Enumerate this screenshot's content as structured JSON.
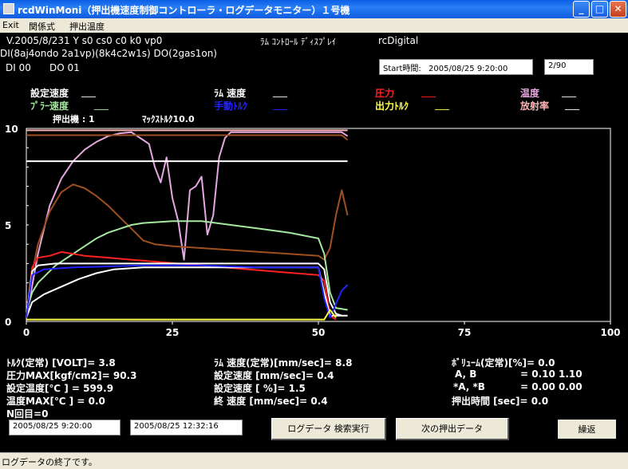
{
  "window": {
    "title": "rcdWinMoni（押出機速度制御コントローラ・ログデータモニター）１号機",
    "minimize": "_",
    "maximize": "□",
    "close": "✕"
  },
  "menu": [
    "Exit",
    "関係式",
    "押出温度"
  ],
  "header": {
    "line1": "V.2005/8/231 Y s0 cs0 c0 k0 vp0",
    "display_title": "ﾗﾑ ｺﾝﾄﾛｰﾙ ﾃﾞｨｽﾌﾟﾚｲ",
    "brand": "rcDigital",
    "line2": "DI(8aj4ondo 2a1vp)(8k4c2w1s)  DO(2gas1on)",
    "di": "DI 00",
    "do": "DO 01",
    "start_label": "Start時間:",
    "start_value": "2005/08/25 9:20:00",
    "counter": "2/90"
  },
  "legend": {
    "row1": [
      {
        "label": "設定速度",
        "value": "___",
        "color": "#ffffff"
      },
      {
        "label": "ﾗﾑ 速度",
        "value": "___",
        "color": "#ffffff"
      },
      {
        "label": "圧力",
        "value": "___",
        "color": "#ff2020"
      },
      {
        "label": "温度",
        "value": "___",
        "color": "#e6a8e0"
      }
    ],
    "row2": [
      {
        "label": "ﾌﾟﾗｰ速度",
        "value": "___",
        "color": "#a6e8a0"
      },
      {
        "label": "手動ﾄﾙｸ",
        "value": "___",
        "color": "#2222ff"
      },
      {
        "label": "出力ﾄﾙｸ",
        "value": "___",
        "color": "#ffff40"
      },
      {
        "label": "放射率",
        "value": "___",
        "color": "#ffb4b4"
      }
    ],
    "extruder": "押出機 : 1",
    "max_torque": "ﾏｯｸｽﾄﾙｸ10.0"
  },
  "chart_data": {
    "type": "line",
    "xlim": [
      0,
      100
    ],
    "ylim": [
      0,
      10
    ],
    "x_ticks": [
      "0",
      "25",
      "50",
      "75",
      "100"
    ],
    "y_ticks": [
      "0",
      "5",
      "10"
    ],
    "series": [
      {
        "name": "温度",
        "color": "#e6a8e0",
        "points": [
          [
            0,
            0.2
          ],
          [
            2,
            3.5
          ],
          [
            4,
            6.0
          ],
          [
            6,
            7.4
          ],
          [
            8,
            8.3
          ],
          [
            10,
            8.9
          ],
          [
            12,
            9.3
          ],
          [
            14,
            9.6
          ],
          [
            16,
            9.75
          ],
          [
            18,
            9.8
          ],
          [
            19,
            9.6
          ],
          [
            20,
            9.4
          ],
          [
            21,
            9.2
          ],
          [
            22,
            8.0
          ],
          [
            23,
            7.2
          ],
          [
            24,
            8.5
          ],
          [
            25,
            6.4
          ],
          [
            26,
            5.2
          ],
          [
            27,
            3.2
          ],
          [
            28,
            6.8
          ],
          [
            29,
            7.0
          ],
          [
            30,
            7.5
          ],
          [
            31,
            4.5
          ],
          [
            32,
            5.5
          ],
          [
            33,
            8.5
          ],
          [
            34,
            9.5
          ],
          [
            35,
            9.8
          ],
          [
            40,
            9.8
          ],
          [
            50,
            9.8
          ],
          [
            54,
            9.8
          ],
          [
            55,
            9.6
          ]
        ]
      },
      {
        "name": "放射率",
        "color": "#ffb4b4",
        "points": [
          [
            0,
            9.9
          ],
          [
            55,
            9.9
          ]
        ]
      },
      {
        "name": "",
        "color": "#ffffff",
        "points": [
          [
            0,
            8.3
          ],
          [
            55,
            8.3
          ]
        ]
      },
      {
        "name": "",
        "color": "#a05020",
        "points": [
          [
            0,
            9.65
          ],
          [
            54,
            9.65
          ],
          [
            55,
            9.4
          ]
        ]
      },
      {
        "name": "",
        "color": "#a05020",
        "points": [
          [
            0,
            0.2
          ],
          [
            1,
            2.5
          ],
          [
            2,
            4.0
          ],
          [
            4,
            5.7
          ],
          [
            6,
            6.7
          ],
          [
            8,
            7.1
          ],
          [
            10,
            6.9
          ],
          [
            12,
            6.5
          ],
          [
            14,
            6.0
          ],
          [
            16,
            5.4
          ],
          [
            18,
            4.8
          ],
          [
            20,
            4.2
          ],
          [
            22,
            4.0
          ],
          [
            25,
            3.9
          ],
          [
            30,
            3.8
          ],
          [
            35,
            3.7
          ],
          [
            40,
            3.6
          ],
          [
            45,
            3.5
          ],
          [
            50,
            3.4
          ],
          [
            51,
            3.2
          ],
          [
            52,
            3.8
          ],
          [
            53,
            5.5
          ],
          [
            54,
            6.8
          ],
          [
            55,
            5.5
          ]
        ]
      },
      {
        "name": "ﾌﾟﾗｰ速度",
        "color": "#a6e8a0",
        "points": [
          [
            0,
            0.5
          ],
          [
            1,
            1.5
          ],
          [
            2,
            2.0
          ],
          [
            5,
            2.9
          ],
          [
            8,
            3.5
          ],
          [
            10,
            3.9
          ],
          [
            12,
            4.3
          ],
          [
            14,
            4.6
          ],
          [
            16,
            4.8
          ],
          [
            18,
            5.0
          ],
          [
            20,
            5.1
          ],
          [
            25,
            5.2
          ],
          [
            30,
            5.2
          ],
          [
            35,
            5.0
          ],
          [
            40,
            4.8
          ],
          [
            45,
            4.6
          ],
          [
            50,
            4.3
          ],
          [
            51,
            3.5
          ],
          [
            52,
            1.5
          ],
          [
            53,
            0.7
          ],
          [
            55,
            0.6
          ]
        ]
      },
      {
        "name": "圧力",
        "color": "#ff2020",
        "points": [
          [
            0,
            0.2
          ],
          [
            1,
            2.8
          ],
          [
            2,
            3.3
          ],
          [
            4,
            3.4
          ],
          [
            6,
            3.6
          ],
          [
            8,
            3.5
          ],
          [
            10,
            3.4
          ],
          [
            14,
            3.3
          ],
          [
            18,
            3.2
          ],
          [
            22,
            3.1
          ],
          [
            26,
            3.0
          ],
          [
            30,
            2.9
          ],
          [
            34,
            2.8
          ],
          [
            38,
            2.7
          ],
          [
            42,
            2.6
          ],
          [
            46,
            2.5
          ],
          [
            50,
            2.4
          ],
          [
            51,
            2.1
          ],
          [
            52,
            0.3
          ],
          [
            53,
            0.1
          ]
        ]
      },
      {
        "name": "ﾗﾑ 速度",
        "color": "#ffffff",
        "points": [
          [
            0,
            0.2
          ],
          [
            1,
            2.6
          ],
          [
            2,
            2.9
          ],
          [
            5,
            3.0
          ],
          [
            10,
            3.0
          ],
          [
            20,
            3.0
          ],
          [
            30,
            3.0
          ],
          [
            40,
            3.0
          ],
          [
            50,
            3.0
          ],
          [
            51,
            2.7
          ],
          [
            52,
            1.0
          ],
          [
            53,
            0.4
          ],
          [
            54,
            0.3
          ],
          [
            55,
            0.3
          ]
        ]
      },
      {
        "name": "設定速度",
        "color": "#ffffff",
        "points": [
          [
            0,
            0.2
          ],
          [
            1,
            1.0
          ],
          [
            3,
            1.4
          ],
          [
            6,
            1.8
          ],
          [
            9,
            2.2
          ],
          [
            12,
            2.5
          ],
          [
            15,
            2.7
          ],
          [
            20,
            2.8
          ],
          [
            30,
            2.8
          ],
          [
            40,
            2.8
          ],
          [
            50,
            2.8
          ],
          [
            51,
            1.5
          ],
          [
            52,
            0.3
          ],
          [
            54,
            0.3
          ]
        ]
      },
      {
        "name": "手動ﾄﾙｸ",
        "color": "#2222ff",
        "points": [
          [
            0,
            0.2
          ],
          [
            1,
            2.4
          ],
          [
            3,
            2.7
          ],
          [
            8,
            2.8
          ],
          [
            20,
            2.9
          ],
          [
            30,
            2.9
          ],
          [
            40,
            2.8
          ],
          [
            50,
            2.8
          ],
          [
            51,
            1.2
          ],
          [
            52,
            0.2
          ],
          [
            54,
            1.6
          ],
          [
            55,
            1.9
          ]
        ]
      },
      {
        "name": "出力ﾄﾙｸ",
        "color": "#ffff40",
        "points": [
          [
            0,
            0.1
          ],
          [
            51,
            0.1
          ],
          [
            52,
            0.6
          ],
          [
            53,
            0.2
          ]
        ]
      }
    ]
  },
  "stats": {
    "torque_label": "ﾄﾙｸ(定常)  [VOLT]=",
    "torque_value": "3.8",
    "pressure_max_label": "圧力MAX[kgf/cm2]=",
    "pressure_max_value": "90.3",
    "set_temp_label": "設定温度[℃   ]  =",
    "set_temp_value": "599.9",
    "temp_max_label": "温度MAX[℃   ]  =",
    "temp_max_value": "0.0",
    "n_label": "N回目=",
    "n_value": "0",
    "ram_speed_label": "ﾗﾑ 速度(定常)[mm/sec]=",
    "ram_speed_value": "8.8",
    "set_speed_label": "設定速度      [mm/sec]=",
    "set_speed_value": "0.4",
    "set_speed_pct_label": "設定速度            [ %]=",
    "set_speed_pct_value": "1.5",
    "end_speed_label": "終  速度      [mm/sec]=",
    "end_speed_value": "0.4",
    "volume_label": "ﾎﾞﾘｭｰﾑ(定常)[%]=",
    "volume_value": "0.0",
    "ab_label": "A,  B",
    "ab_value": "= 0.10 1.10",
    "ab2_label": "*A,  *B",
    "ab2_value": "= 0.00 0.00",
    "push_time_label": "押出時間   [sec]=",
    "push_time_value": "0.0"
  },
  "footer": {
    "date_from": "2005/08/25 9:20:00",
    "date_to": "2005/08/25 12:32:16",
    "search_button": "ログデータ  検索実行",
    "next_button": "次の押出データ",
    "repeat_button": "繰返"
  },
  "status": "ログデータの終了です。"
}
